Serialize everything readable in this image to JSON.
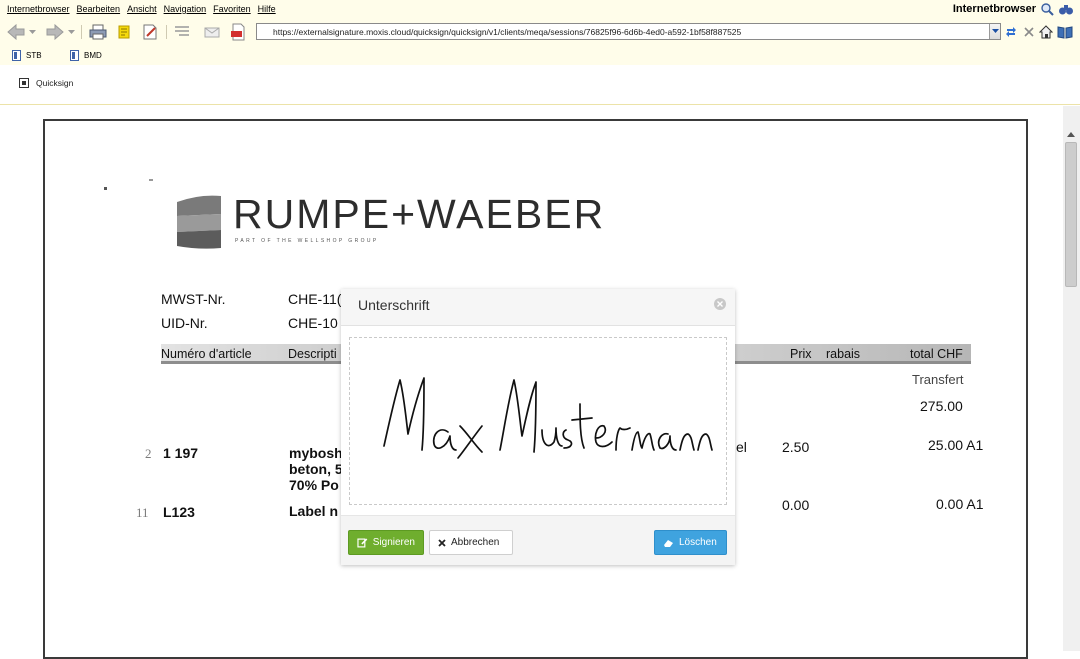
{
  "menubar": {
    "items": [
      "Internetbrowser",
      "Bearbeiten",
      "Ansicht",
      "Navigation",
      "Favoriten",
      "Hilfe"
    ],
    "brand": "Internetbrowser"
  },
  "toolbar": {
    "url": "https://externalsignature.moxis.cloud/quicksign/quicksign/v1/clients/meqa/sessions/76825f96-6d6b-4ed0-a592-1bf58f887525"
  },
  "bookmarks": [
    "STB",
    "BMD"
  ],
  "app": {
    "tab_label": "Quicksign"
  },
  "document": {
    "logo_text": "RUMPE+WAEBER",
    "logo_sub": "PART OF THE WELLSHOP GROUP",
    "mwst_label": "MWST-Nr.",
    "mwst_value": "CHE-11(",
    "uid_label": "UID-Nr.",
    "uid_value": "CHE-10",
    "columns": [
      "Numéro d'article",
      "Descripti",
      "Prix",
      "rabais",
      "total CHF"
    ],
    "transfer_label": "Transfert",
    "transfer_value": "275.00",
    "rows": [
      {
        "pos": "2",
        "article": "1 197",
        "desc": [
          "myboshl",
          "beton, 5",
          "70% Po"
        ],
        "unit": "el",
        "price": "2.50",
        "total": "25.00 A1"
      },
      {
        "pos": "11",
        "article": "L123",
        "desc": [
          "Label n"
        ],
        "unit": "",
        "price": "0.00",
        "total": "0.00 A1"
      }
    ]
  },
  "modal": {
    "title": "Unterschrift",
    "signature_text": "Max Mustermann",
    "buttons": {
      "sign": "Signieren",
      "cancel": "Abbrechen",
      "clear": "Löschen"
    }
  }
}
